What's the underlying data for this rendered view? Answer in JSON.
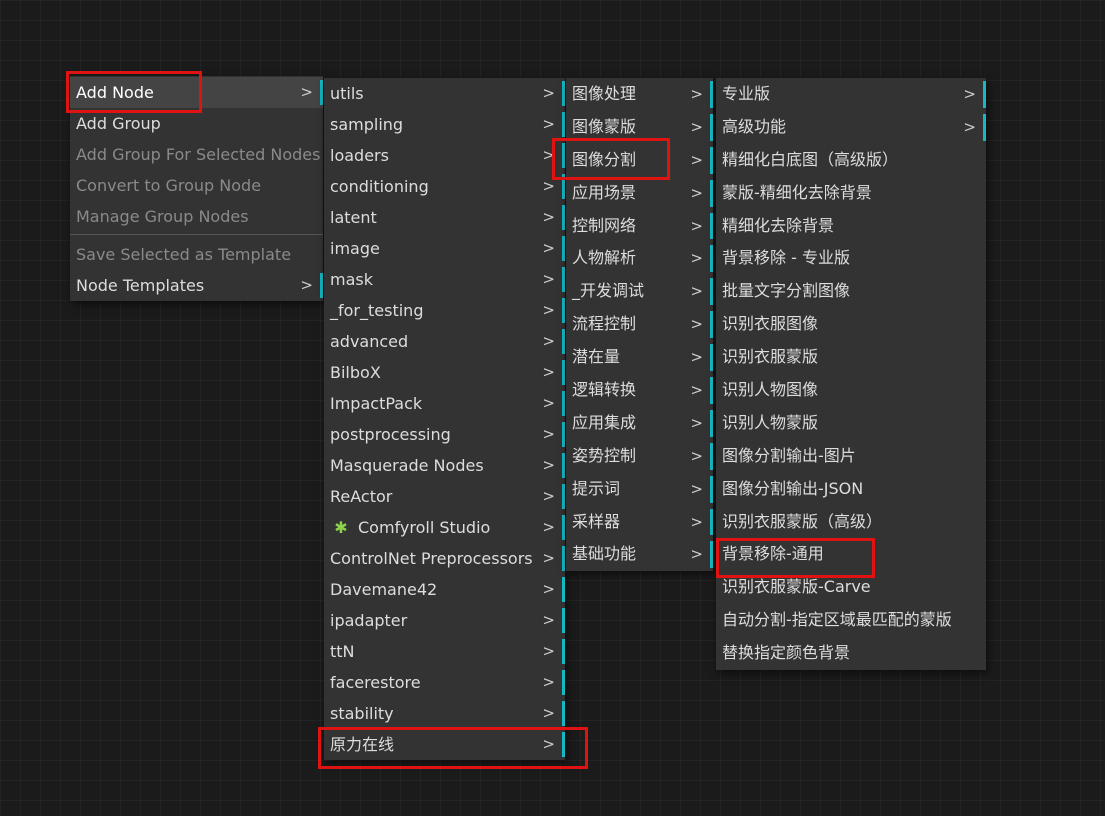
{
  "menu1": {
    "items": [
      {
        "label": "Add Node",
        "arrow": ">",
        "disabled": false,
        "submenu": true
      },
      {
        "label": "Add Group",
        "arrow": "",
        "disabled": false,
        "submenu": false
      },
      {
        "label": "Add Group For Selected Nodes",
        "arrow": "",
        "disabled": true,
        "submenu": false
      },
      {
        "label": "Convert to Group Node",
        "arrow": "",
        "disabled": true,
        "submenu": false
      },
      {
        "label": "Manage Group Nodes",
        "arrow": "",
        "disabled": true,
        "submenu": false
      },
      {
        "label": "Save Selected as Template",
        "arrow": "",
        "disabled": true,
        "submenu": false
      },
      {
        "label": "Node Templates",
        "arrow": ">",
        "disabled": false,
        "submenu": true
      }
    ]
  },
  "menu2": {
    "items": [
      {
        "label": "utils",
        "arrow": ">"
      },
      {
        "label": "sampling",
        "arrow": ">"
      },
      {
        "label": "loaders",
        "arrow": ">"
      },
      {
        "label": "conditioning",
        "arrow": ">"
      },
      {
        "label": "latent",
        "arrow": ">"
      },
      {
        "label": "image",
        "arrow": ">"
      },
      {
        "label": "mask",
        "arrow": ">"
      },
      {
        "label": "_for_testing",
        "arrow": ">"
      },
      {
        "label": "advanced",
        "arrow": ">"
      },
      {
        "label": "BilboX",
        "arrow": ">"
      },
      {
        "label": "ImpactPack",
        "arrow": ">"
      },
      {
        "label": "postprocessing",
        "arrow": ">"
      },
      {
        "label": "Masquerade Nodes",
        "arrow": ">"
      },
      {
        "label": "ReActor",
        "arrow": ">"
      },
      {
        "label": "Comfyroll Studio",
        "arrow": ">",
        "icon": "puzzle-icon"
      },
      {
        "label": "ControlNet Preprocessors",
        "arrow": ">"
      },
      {
        "label": "Davemane42",
        "arrow": ">"
      },
      {
        "label": "ipadapter",
        "arrow": ">"
      },
      {
        "label": "ttN",
        "arrow": ">"
      },
      {
        "label": "facerestore",
        "arrow": ">"
      },
      {
        "label": "stability",
        "arrow": ">"
      },
      {
        "label": "原力在线",
        "arrow": ">"
      }
    ]
  },
  "menu3": {
    "items": [
      {
        "label": "图像处理",
        "arrow": ">"
      },
      {
        "label": "图像蒙版",
        "arrow": ">"
      },
      {
        "label": "图像分割",
        "arrow": ">"
      },
      {
        "label": "应用场景",
        "arrow": ">"
      },
      {
        "label": "控制网络",
        "arrow": ">"
      },
      {
        "label": "人物解析",
        "arrow": ">"
      },
      {
        "label": "_开发调试",
        "arrow": ">"
      },
      {
        "label": "流程控制",
        "arrow": ">"
      },
      {
        "label": "潜在量",
        "arrow": ">"
      },
      {
        "label": "逻辑转换",
        "arrow": ">"
      },
      {
        "label": "应用集成",
        "arrow": ">"
      },
      {
        "label": "姿势控制",
        "arrow": ">"
      },
      {
        "label": "提示词",
        "arrow": ">"
      },
      {
        "label": "采样器",
        "arrow": ">"
      },
      {
        "label": "基础功能",
        "arrow": ">"
      }
    ]
  },
  "menu4": {
    "items": [
      {
        "label": "专业版",
        "arrow": ">",
        "submenu": true
      },
      {
        "label": "高级功能",
        "arrow": ">",
        "submenu": true
      },
      {
        "label": "精细化白底图（高级版）",
        "arrow": "",
        "submenu": false
      },
      {
        "label": "蒙版-精细化去除背景",
        "arrow": "",
        "submenu": false
      },
      {
        "label": "精细化去除背景",
        "arrow": "",
        "submenu": false
      },
      {
        "label": "背景移除 - 专业版",
        "arrow": "",
        "submenu": false
      },
      {
        "label": "批量文字分割图像",
        "arrow": "",
        "submenu": false
      },
      {
        "label": "识别衣服图像",
        "arrow": "",
        "submenu": false
      },
      {
        "label": "识别衣服蒙版",
        "arrow": "",
        "submenu": false
      },
      {
        "label": "识别人物图像",
        "arrow": "",
        "submenu": false
      },
      {
        "label": "识别人物蒙版",
        "arrow": "",
        "submenu": false
      },
      {
        "label": "图像分割输出-图片",
        "arrow": "",
        "submenu": false
      },
      {
        "label": "图像分割输出-JSON",
        "arrow": "",
        "submenu": false
      },
      {
        "label": "识别衣服蒙版（高级）",
        "arrow": "",
        "submenu": false
      },
      {
        "label": "背景移除-通用",
        "arrow": "",
        "submenu": false
      },
      {
        "label": "识别衣服蒙版-Carve",
        "arrow": "",
        "submenu": false
      },
      {
        "label": "自动分割-指定区域最匹配的蒙版",
        "arrow": "",
        "submenu": false
      },
      {
        "label": "替换指定颜色背景",
        "arrow": "",
        "submenu": false
      }
    ]
  },
  "colors": {
    "accent": "#16b8c4",
    "highlight_box": "#e01313",
    "menu_bg": "#333333",
    "canvas_bg": "#1b1b1b"
  }
}
